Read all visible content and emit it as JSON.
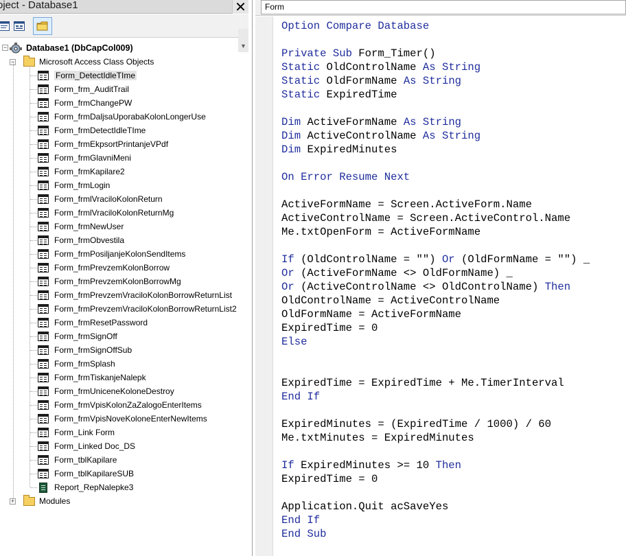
{
  "project_explorer": {
    "title": "oject - Database1",
    "close_glyph": "✕",
    "toolbar": {
      "view_code_icon": "view-code-icon",
      "view_object_icon": "view-object-icon",
      "toggle_folders_icon": "folder-icon"
    },
    "root": {
      "label": "Database1 (DbCapCol009)",
      "icon": "project-icon"
    },
    "class_objects_folder": {
      "label": "Microsoft Access Class Objects",
      "expander": "−"
    },
    "items": [
      {
        "label": "Form_DetectIdleTIme",
        "type": "form",
        "selected": true
      },
      {
        "label": "Form_frm_AuditTrail",
        "type": "form"
      },
      {
        "label": "Form_frmChangePW",
        "type": "form"
      },
      {
        "label": "Form_frmDaljsaUporabaKolonLongerUse",
        "type": "form"
      },
      {
        "label": "Form_frmDetectIdleTIme",
        "type": "form"
      },
      {
        "label": "Form_frmEkpsortPrintanjeVPdf",
        "type": "form"
      },
      {
        "label": "Form_frmGlavniMeni",
        "type": "form"
      },
      {
        "label": "Form_frmKapilare2",
        "type": "form"
      },
      {
        "label": "Form_frmLogin",
        "type": "form"
      },
      {
        "label": "Form_frmlVraciloKolonReturn",
        "type": "form"
      },
      {
        "label": "Form_frmlVraciloKolonReturnMg",
        "type": "form"
      },
      {
        "label": "Form_frmNewUser",
        "type": "form"
      },
      {
        "label": "Form_frmObvestila",
        "type": "form"
      },
      {
        "label": "Form_frmPosiljanjeKolonSendItems",
        "type": "form"
      },
      {
        "label": "Form_frmPrevzemKolonBorrow",
        "type": "form"
      },
      {
        "label": "Form_frmPrevzemKolonBorrowMg",
        "type": "form"
      },
      {
        "label": "Form_frmPrevzemVraciloKolonBorrowReturnList",
        "type": "form"
      },
      {
        "label": "Form_frmPrevzemVraciloKolonBorrowReturnList2",
        "type": "form"
      },
      {
        "label": "Form_frmResetPassword",
        "type": "form"
      },
      {
        "label": "Form_frmSignOff",
        "type": "form"
      },
      {
        "label": "Form_frmSignOffSub",
        "type": "form"
      },
      {
        "label": "Form_frmSplash",
        "type": "form"
      },
      {
        "label": "Form_frmTiskanjeNalepk",
        "type": "form"
      },
      {
        "label": "Form_frmUniceneKoloneDestroy",
        "type": "form"
      },
      {
        "label": "Form_frmVpisKolonZaZalogoEnterItems",
        "type": "form"
      },
      {
        "label": "Form_frmVpisNoveKoloneEnterNewItems",
        "type": "form"
      },
      {
        "label": "Form_Link Form",
        "type": "form"
      },
      {
        "label": "Form_Linked Doc_DS",
        "type": "form"
      },
      {
        "label": "Form_tblKapilare",
        "type": "form"
      },
      {
        "label": "Form_tblKapilareSUB",
        "type": "form"
      },
      {
        "label": "Report_RepNalepke3",
        "type": "report"
      }
    ],
    "modules_folder": {
      "label": "Modules",
      "expander": "+"
    }
  },
  "code_window": {
    "object_dropdown_value": "Form",
    "lines": [
      [
        {
          "t": "Option Compare Database",
          "k": true
        }
      ],
      [],
      [
        {
          "t": "Private Sub ",
          "k": true
        },
        {
          "t": "Form_Timer()",
          "k": false
        }
      ],
      [
        {
          "t": "Static ",
          "k": true
        },
        {
          "t": "OldControlName ",
          "k": false
        },
        {
          "t": "As String",
          "k": true
        }
      ],
      [
        {
          "t": "Static ",
          "k": true
        },
        {
          "t": "OldFormName ",
          "k": false
        },
        {
          "t": "As String",
          "k": true
        }
      ],
      [
        {
          "t": "Static ",
          "k": true
        },
        {
          "t": "ExpiredTime",
          "k": false
        }
      ],
      [],
      [
        {
          "t": "Dim ",
          "k": true
        },
        {
          "t": "ActiveFormName ",
          "k": false
        },
        {
          "t": "As String",
          "k": true
        }
      ],
      [
        {
          "t": "Dim ",
          "k": true
        },
        {
          "t": "ActiveControlName ",
          "k": false
        },
        {
          "t": "As String",
          "k": true
        }
      ],
      [
        {
          "t": "Dim ",
          "k": true
        },
        {
          "t": "ExpiredMinutes",
          "k": false
        }
      ],
      [],
      [
        {
          "t": "On Error Resume Next",
          "k": true
        }
      ],
      [],
      [
        {
          "t": "ActiveFormName = Screen.ActiveForm.Name",
          "k": false
        }
      ],
      [
        {
          "t": "ActiveControlName = Screen.ActiveControl.Name",
          "k": false
        }
      ],
      [
        {
          "t": "Me.txtOpenForm = ActiveFormName",
          "k": false
        }
      ],
      [],
      [
        {
          "t": "If ",
          "k": true
        },
        {
          "t": "(OldControlName = \"\") ",
          "k": false
        },
        {
          "t": "Or ",
          "k": true
        },
        {
          "t": "(OldFormName = \"\") _",
          "k": false
        }
      ],
      [
        {
          "t": "Or ",
          "k": true
        },
        {
          "t": "(ActiveFormName <> OldFormName) _",
          "k": false
        }
      ],
      [
        {
          "t": "Or ",
          "k": true
        },
        {
          "t": "(ActiveControlName <> OldControlName) ",
          "k": false
        },
        {
          "t": "Then",
          "k": true
        }
      ],
      [
        {
          "t": "OldControlName = ActiveControlName",
          "k": false
        }
      ],
      [
        {
          "t": "OldFormName = ActiveFormName",
          "k": false
        }
      ],
      [
        {
          "t": "ExpiredTime = 0",
          "k": false
        }
      ],
      [
        {
          "t": "Else",
          "k": true
        }
      ],
      [],
      [],
      [
        {
          "t": "ExpiredTime = ExpiredTime + Me.TimerInterval",
          "k": false
        }
      ],
      [
        {
          "t": "End If",
          "k": true
        }
      ],
      [],
      [
        {
          "t": "ExpiredMinutes = (ExpiredTime / 1000) / 60",
          "k": false
        }
      ],
      [
        {
          "t": "Me.txtMinutes = ExpiredMinutes",
          "k": false
        }
      ],
      [],
      [
        {
          "t": "If ",
          "k": true
        },
        {
          "t": "ExpiredMinutes >= 10 ",
          "k": false
        },
        {
          "t": "Then",
          "k": true
        }
      ],
      [
        {
          "t": "ExpiredTime = 0",
          "k": false
        }
      ],
      [],
      [
        {
          "t": "Application.Quit acSaveYes",
          "k": false
        }
      ],
      [
        {
          "t": "End If",
          "k": true
        }
      ],
      [
        {
          "t": "End Sub",
          "k": true
        }
      ]
    ]
  },
  "colors": {
    "keyword": "#1f2d9c",
    "text": "#000000",
    "selection": "#e4e4e4"
  }
}
